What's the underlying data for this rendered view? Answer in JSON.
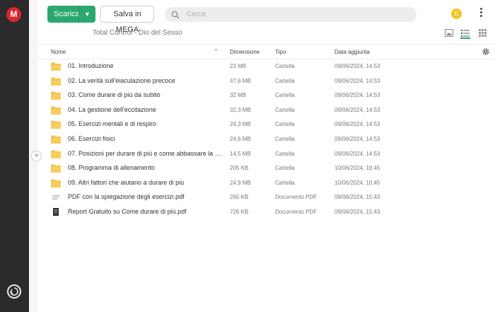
{
  "logo": "M",
  "toolbar": {
    "download_label": "Scarica",
    "save_label": "Salva in MEGA",
    "search_placeholder": "Cerca",
    "avatar_initial": "E"
  },
  "folder_title": "Total Control - Dio del Sesso",
  "table": {
    "headers": {
      "name": "Nome",
      "size": "Dimensione",
      "type": "Tipo",
      "date": "Data aggiunta"
    },
    "rows": [
      {
        "name": "01. Introduzione",
        "size": "23 MB",
        "type": "Cartella",
        "date": "09/06/2024, 14:53",
        "icon": "folder-icon"
      },
      {
        "name": "02. La verità sull'eiaculazione precoce",
        "size": "47,6 MB",
        "type": "Cartella",
        "date": "09/06/2024, 14:53",
        "icon": "folder-icon"
      },
      {
        "name": "03. Come durare di più da subito",
        "size": "32 MB",
        "type": "Cartella",
        "date": "09/06/2024, 14:53",
        "icon": "folder-icon"
      },
      {
        "name": "04. La gestione dell'eccitazione",
        "size": "32,3 MB",
        "type": "Cartella",
        "date": "09/06/2024, 14:53",
        "icon": "folder-icon"
      },
      {
        "name": "05. Esercizi mentali e di respiro",
        "size": "24,3 MB",
        "type": "Cartella",
        "date": "09/06/2024, 14:53",
        "icon": "folder-icon"
      },
      {
        "name": "06. Esercizi fisici",
        "size": "24,6 MB",
        "type": "Cartella",
        "date": "09/06/2024, 14:53",
        "icon": "folder-icon"
      },
      {
        "name": "07. Posizioni per durare di più e come abbassare la su...",
        "size": "14,5 MB",
        "type": "Cartella",
        "date": "09/06/2024, 14:53",
        "icon": "folder-icon"
      },
      {
        "name": "08. Programma di allenamento",
        "size": "205 KB",
        "type": "Cartella",
        "date": "10/06/2024, 10:45",
        "icon": "folder-icon"
      },
      {
        "name": "09. Altri fattori che aiutano a durare di più",
        "size": "24,9 MB",
        "type": "Cartella",
        "date": "10/06/2024, 10:45",
        "icon": "folder-icon"
      },
      {
        "name": "PDF con la spiegazione degli esercizi.pdf",
        "size": "265 KB",
        "type": "Documento PDF",
        "date": "09/06/2024, 15:43",
        "icon": "pdf-doc-icon"
      },
      {
        "name": "Report Gratuito su Come durare di più.pdf",
        "size": "726 KB",
        "type": "Documento PDF",
        "date": "09/06/2024, 15:43",
        "icon": "pdf-thumb-icon"
      }
    ]
  },
  "colors": {
    "accent": "#2aa870",
    "brand": "#d9272e",
    "folder": "#f5c04a",
    "rail": "#2b2b2d"
  }
}
